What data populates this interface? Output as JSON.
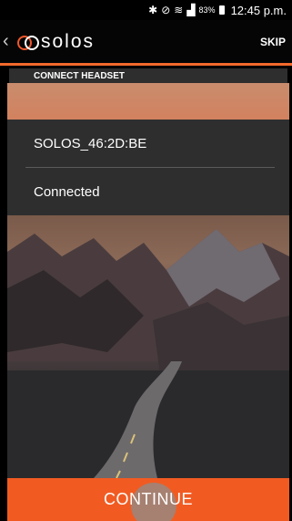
{
  "statusbar": {
    "icons": [
      "bluetooth-icon",
      "mute-icon",
      "wifi-icon",
      "signal-icon"
    ],
    "battery_percent": "83%",
    "time": "12:45 p.m."
  },
  "appbar": {
    "back_icon": "chevron-left-icon",
    "logo_text": "solos",
    "skip_label": "SKIP"
  },
  "section": {
    "title": "CONNECT HEADSET"
  },
  "device": {
    "name": "SOLOS_46:2D:BE",
    "status": "Connected"
  },
  "footer": {
    "continue_label": "CONTINUE"
  },
  "colors": {
    "accent": "#f15b22",
    "panel": "#303030"
  }
}
